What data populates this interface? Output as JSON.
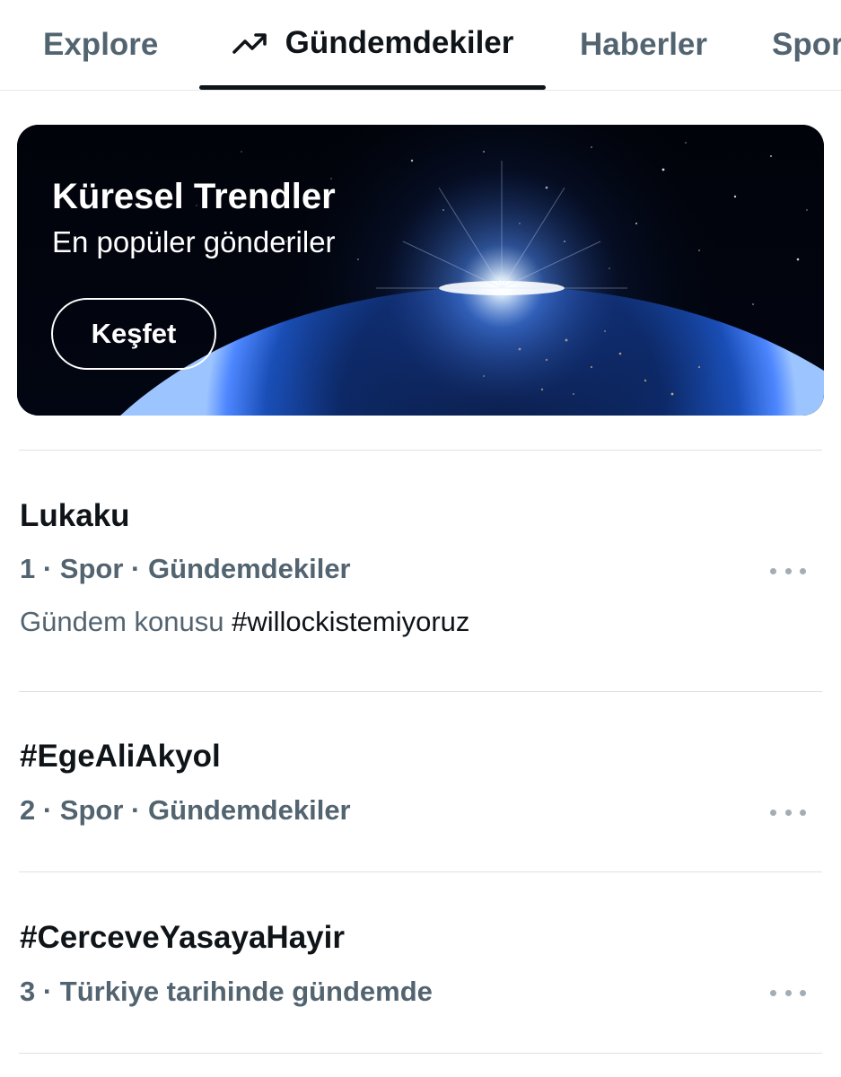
{
  "tabs": [
    {
      "label": "Explore",
      "active": false
    },
    {
      "label": "Gündemdekiler",
      "active": true,
      "icon": "trending-arrow-icon"
    },
    {
      "label": "Haberler",
      "active": false
    },
    {
      "label": "Spor",
      "active": false
    }
  ],
  "banner": {
    "title": "Küresel Trendler",
    "subtitle": "En popüler gönderiler",
    "button_label": "Keşfet",
    "image": "earth-from-space"
  },
  "trends": [
    {
      "title": "Lukaku",
      "meta": "1 · Spor · Gündemdekiler",
      "context_prefix": "Gündem konusu",
      "context_hashtag": "#willockistemiyoruz"
    },
    {
      "title": "#EgeAliAkyol",
      "meta": "2 · Spor · Gündemdekiler"
    },
    {
      "title": "#CerceveYasayaHayir",
      "meta": "3 · Türkiye tarihinde gündemde"
    }
  ],
  "colors": {
    "text_primary": "#0f1419",
    "text_secondary": "#536471",
    "divider": "#dde1e4",
    "more_dots": "#a3adb6"
  }
}
